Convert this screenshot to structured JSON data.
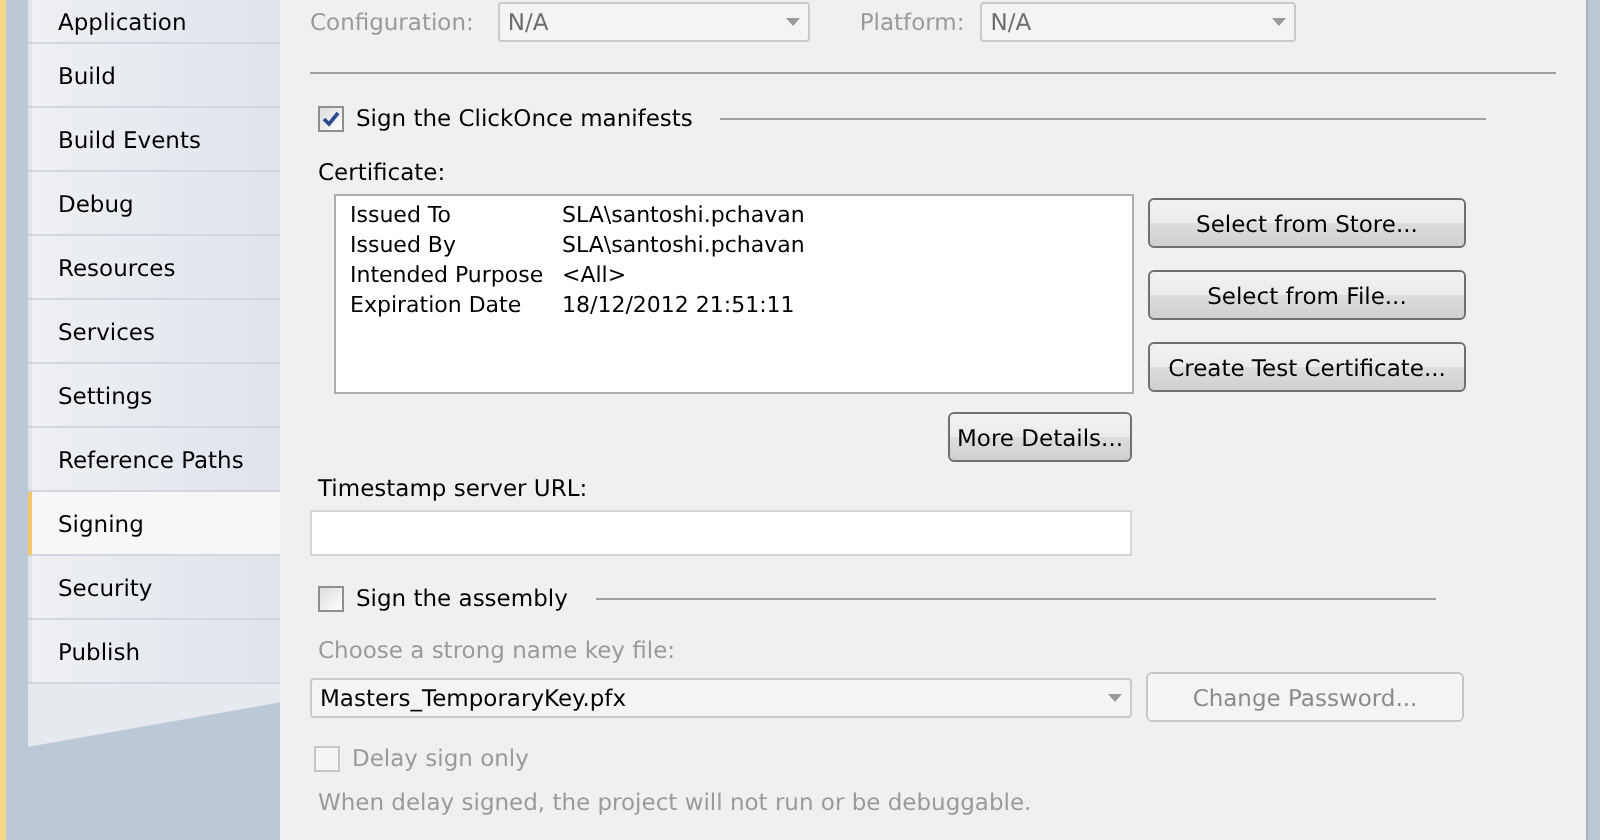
{
  "sidebar": {
    "tabs": [
      {
        "label": "Application",
        "selected": false
      },
      {
        "label": "Build",
        "selected": false
      },
      {
        "label": "Build Events",
        "selected": false
      },
      {
        "label": "Debug",
        "selected": false
      },
      {
        "label": "Resources",
        "selected": false
      },
      {
        "label": "Services",
        "selected": false
      },
      {
        "label": "Settings",
        "selected": false
      },
      {
        "label": "Reference Paths",
        "selected": false
      },
      {
        "label": "Signing",
        "selected": true
      },
      {
        "label": "Security",
        "selected": false
      },
      {
        "label": "Publish",
        "selected": false
      }
    ]
  },
  "configuration": {
    "label": "Configuration:",
    "value": "N/A",
    "disabled": true
  },
  "platform": {
    "label": "Platform:",
    "value": "N/A",
    "disabled": true
  },
  "sign_manifests": {
    "label": "Sign the ClickOnce manifests",
    "checked": true
  },
  "certificate": {
    "label": "Certificate:",
    "fields": [
      {
        "name": "Issued To",
        "value": "SLA\\santoshi.pchavan"
      },
      {
        "name": "Issued By",
        "value": "SLA\\santoshi.pchavan"
      },
      {
        "name": "Intended Purpose",
        "value": "<All>"
      },
      {
        "name": "Expiration Date",
        "value": "18/12/2012 21:51:11"
      }
    ]
  },
  "certificate_buttons": [
    {
      "label": "Select from Store..."
    },
    {
      "label": "Select from File..."
    },
    {
      "label": "Create Test Certificate..."
    }
  ],
  "more_details": {
    "label": "More Details..."
  },
  "timestamp": {
    "label": "Timestamp server URL:"
  },
  "sign_assembly": {
    "label": "Sign the assembly",
    "checked": false
  },
  "key_file": {
    "label": "Choose a strong name key file:",
    "value": "Masters_TemporaryKey.pfx",
    "disabled": true
  },
  "change_password": {
    "label": "Change Password...",
    "disabled": true
  },
  "delay_sign": {
    "label": "Delay sign only",
    "checked": false,
    "disabled": true
  },
  "note": {
    "text": "When delay signed, the project will not run or be debuggable.",
    "disabled": true
  }
}
